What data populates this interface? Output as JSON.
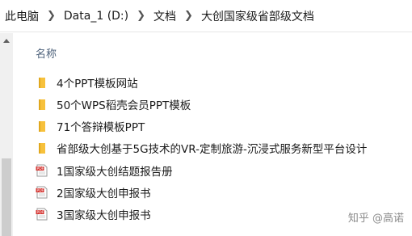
{
  "breadcrumb": {
    "items": [
      "此电脑",
      "Data_1 (D:)",
      "文档",
      "大创国家级省部级文档"
    ]
  },
  "column_header": "名称",
  "files": [
    {
      "name": "4个PPT模板网站",
      "type": "folder"
    },
    {
      "name": "50个WPS稻壳会员PPT模板",
      "type": "folder"
    },
    {
      "name": "71个答辩模板PPT",
      "type": "folder"
    },
    {
      "name": "省部级大创基于5G技术的VR-定制旅游-沉浸式服务新型平台设计",
      "type": "folder"
    },
    {
      "name": "1国家级大创结题报告册",
      "type": "pdf"
    },
    {
      "name": "2国家级大创申报书",
      "type": "pdf"
    },
    {
      "name": "3国家级大创申报书",
      "type": "pdf"
    }
  ],
  "watermark": "知乎 @高诺",
  "colors": {
    "folder": "#f7c13c",
    "pdf": "#d4332f",
    "header_text": "#4c607a"
  }
}
